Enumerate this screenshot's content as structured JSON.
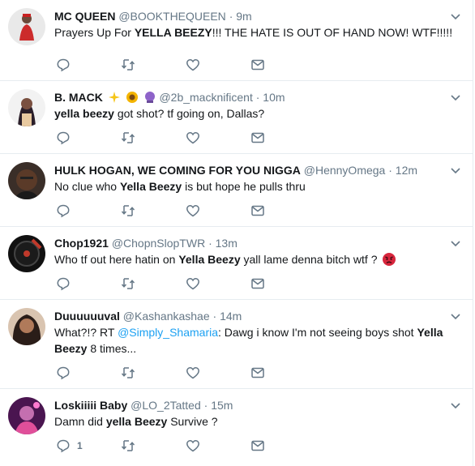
{
  "colors": {
    "text": "#14171a",
    "muted": "#657786",
    "link": "#1da1f2",
    "border": "#e6ecf0"
  },
  "tweets": [
    {
      "name": "MC QUEEN",
      "handle": "@BOOKTHEQUEEN",
      "dot": "·",
      "time": "9m",
      "text_parts": [
        "Prayers Up For ",
        "YELLA BEEZY",
        "!!! THE HATE IS OUT OF HAND NOW! WTF!!!!!"
      ],
      "reply_count": ""
    },
    {
      "name": "B. MACK",
      "handle": "@2b_macknificent",
      "dot": "·",
      "time": "10m",
      "name_emojis": [
        "sparkles",
        "sunflower",
        "crystal-ball"
      ],
      "text_parts": [
        "yella beezy",
        " got shot? tf going on, Dallas?"
      ],
      "reply_count": ""
    },
    {
      "name": "HULK HOGAN, WE COMING FOR YOU NIGGA",
      "handle": "@HennyOmega",
      "dot": "·",
      "time": "12m",
      "text_parts": [
        "No clue who ",
        "Yella Beezy",
        " is but hope he pulls thru"
      ],
      "reply_count": ""
    },
    {
      "name": "Chop1921",
      "handle": "@ChopnSlopTWR",
      "dot": "·",
      "time": "13m",
      "text_parts": [
        "Who tf out here hatin on ",
        "Yella Beezy",
        " yall lame denna bitch wtf ?"
      ],
      "text_emoji": "angry-face",
      "reply_count": ""
    },
    {
      "name": "Duuuuuuval",
      "handle": "@Kashankashae",
      "dot": "·",
      "time": "14m",
      "text_parts": [
        "What?!? RT ",
        "@Simply_Shamaria",
        ": Dawg i know I'm not seeing boys shot ",
        "Yella",
        "Beezy",
        " 8 times..."
      ],
      "reply_count": ""
    },
    {
      "name": "Loskiiiii Baby",
      "handle": "@LO_2Tatted",
      "dot": "·",
      "time": "15m",
      "text_parts": [
        "Damn did ",
        "yella Beezy",
        " Survive ?"
      ],
      "reply_count": "1"
    }
  ]
}
